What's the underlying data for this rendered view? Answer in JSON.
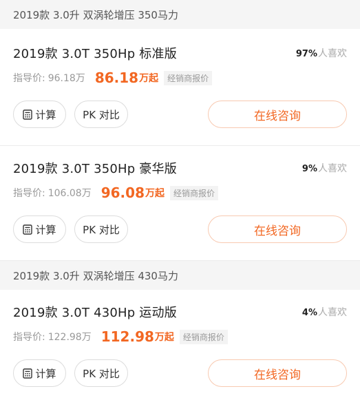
{
  "sections": [
    {
      "header": "2019款 3.0升 双涡轮增压 350马力",
      "cards": [
        {
          "name": "2019款 3.0T 350Hp 标准版",
          "like_pct": "97%",
          "like_label": "人喜欢",
          "guide_label": "指导价:",
          "guide_price": "96.18万",
          "dealer_price": "86.18",
          "dealer_unit": "万起",
          "dealer_tag": "经销商报价",
          "calc_label": "计算",
          "pk_label": "PK 对比",
          "consult_label": "在线咨询"
        },
        {
          "name": "2019款 3.0T 350Hp 豪华版",
          "like_pct": "9%",
          "like_label": "人喜欢",
          "guide_label": "指导价:",
          "guide_price": "106.08万",
          "dealer_price": "96.08",
          "dealer_unit": "万起",
          "dealer_tag": "经销商报价",
          "calc_label": "计算",
          "pk_label": "PK 对比",
          "consult_label": "在线咨询"
        }
      ]
    },
    {
      "header": "2019款 3.0升 双涡轮增压 430马力",
      "cards": [
        {
          "name": "2019款 3.0T 430Hp 运动版",
          "like_pct": "4%",
          "like_label": "人喜欢",
          "guide_label": "指导价:",
          "guide_price": "122.98万",
          "dealer_price": "112.98",
          "dealer_unit": "万起",
          "dealer_tag": "经销商报价",
          "calc_label": "计算",
          "pk_label": "PK 对比",
          "consult_label": "在线咨询"
        }
      ]
    }
  ],
  "colors": {
    "accent": "#f26722",
    "header_bg": "#f5f5f5"
  }
}
